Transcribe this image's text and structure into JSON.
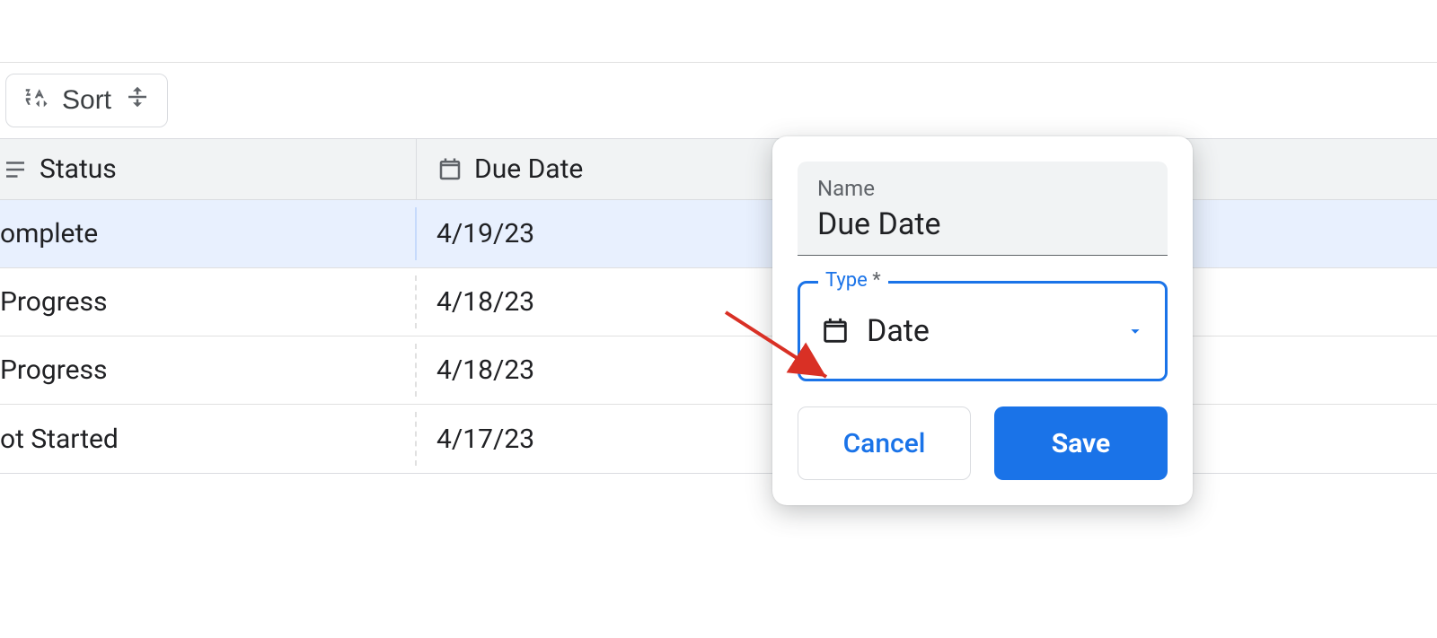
{
  "toolbar": {
    "sort_label": "Sort"
  },
  "table": {
    "headers": {
      "status": "Status",
      "due": "Due Date"
    },
    "rows": [
      {
        "status": "omplete",
        "due": "4/19/23",
        "selected": true
      },
      {
        "status": "Progress",
        "due": "4/18/23",
        "selected": false
      },
      {
        "status": "Progress",
        "due": "4/18/23",
        "selected": false
      },
      {
        "status": "ot Started",
        "due": "4/17/23",
        "selected": false
      }
    ]
  },
  "dialog": {
    "name_label": "Name",
    "name_value": "Due Date",
    "type_label": "Type",
    "type_required_marker": "*",
    "type_value": "Date",
    "cancel_label": "Cancel",
    "save_label": "Save"
  }
}
